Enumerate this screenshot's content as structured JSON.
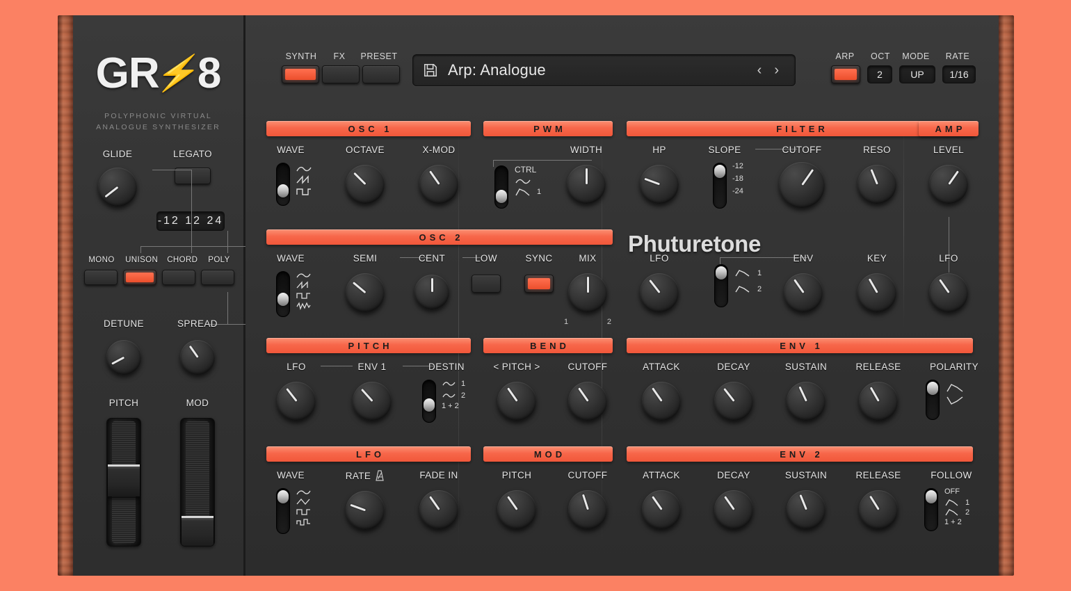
{
  "app": {
    "brand_logo": "GR",
    "brand_bolt": "⚡",
    "brand_number": "8",
    "tagline_line1": "POLYPHONIC VIRTUAL",
    "tagline_line2": "ANALOGUE SYNTHESIZER",
    "watermark": "Phuturetone",
    "accent_color": "#f1573a",
    "panel_color": "#333333",
    "wood_color": "#b35f40"
  },
  "toolbar": {
    "page_tabs": [
      {
        "label": "SYNTH",
        "active": true
      },
      {
        "label": "FX",
        "active": false
      },
      {
        "label": "PRESET",
        "active": false
      }
    ],
    "preset": {
      "save_icon": "floppy-disk-icon",
      "name": "Arp: Analogue",
      "prev": "‹",
      "next": "›"
    },
    "arp": {
      "label": "ARP",
      "enabled": true,
      "oct_label": "OCT",
      "oct_value": "2",
      "mode_label": "MODE",
      "mode_value": "UP",
      "rate_label": "RATE",
      "rate_value": "1/16"
    }
  },
  "left_panel": {
    "glide": {
      "label": "GLIDE",
      "angle": -128
    },
    "legato": {
      "label": "LEGATO",
      "on": false
    },
    "chord_readout": "-12 12 24",
    "voice_modes": [
      {
        "label": "MONO",
        "active": false
      },
      {
        "label": "UNISON",
        "active": true
      },
      {
        "label": "CHORD",
        "active": false
      },
      {
        "label": "POLY",
        "active": false
      }
    ],
    "detune": {
      "label": "DETUNE",
      "angle": -118
    },
    "spread": {
      "label": "SPREAD",
      "angle": -35
    },
    "pitch_wheel": {
      "label": "PITCH",
      "position": 50
    },
    "mod_wheel": {
      "label": "MOD",
      "position": 5
    }
  },
  "sections": {
    "osc1": {
      "title": "OSC 1",
      "wave": {
        "label": "WAVE",
        "options": [
          "sine",
          "saw",
          "square"
        ],
        "selected": 1
      },
      "octave": {
        "label": "OCTAVE",
        "angle": -45
      },
      "xmod": {
        "label": "X-MOD",
        "angle": -35
      }
    },
    "pwm": {
      "title": "PWM",
      "ctrl": {
        "label": "CTRL",
        "options": [
          "sine",
          "env-1"
        ],
        "option_labels": [
          "",
          "1"
        ],
        "selected": 1
      },
      "width": {
        "label": "WIDTH",
        "angle": 0
      }
    },
    "osc2": {
      "title": "OSC 2",
      "wave": {
        "label": "WAVE",
        "options": [
          "sine",
          "saw",
          "square",
          "noise"
        ],
        "selected": 1
      },
      "semi": {
        "label": "SEMI",
        "angle": -50
      },
      "cent": {
        "label": "CENT",
        "angle": 0
      },
      "low": {
        "label": "LOW",
        "on": false
      },
      "sync": {
        "label": "SYNC",
        "on": true
      },
      "mix": {
        "label": "MIX",
        "angle": 0,
        "min_label": "1",
        "max_label": "2"
      }
    },
    "pitch": {
      "title": "PITCH",
      "lfo": {
        "label": "LFO",
        "angle": -38
      },
      "env1": {
        "label": "ENV 1",
        "angle": -42
      },
      "destin": {
        "label": "DESTIN",
        "options": [
          "osc-1",
          "osc-2",
          "1 + 2"
        ],
        "option_labels": [
          "1",
          "2",
          "1 + 2"
        ],
        "selected": 1
      }
    },
    "bend": {
      "title": "BEND",
      "pitch": {
        "label": "< PITCH >",
        "angle": -35
      },
      "cutoff": {
        "label": "CUTOFF",
        "angle": -35
      }
    },
    "lfo": {
      "title": "LFO",
      "wave": {
        "label": "WAVE",
        "options": [
          "sine",
          "triangle",
          "square",
          "random"
        ],
        "selected": 0
      },
      "rate": {
        "label": "RATE",
        "icon": "metronome-icon",
        "angle": -70
      },
      "fade_in": {
        "label": "FADE IN",
        "angle": -35
      }
    },
    "mod": {
      "title": "MOD",
      "pitch": {
        "label": "PITCH",
        "angle": -35
      },
      "cutoff": {
        "label": "CUTOFF",
        "angle": -18
      }
    },
    "filter": {
      "title": "FILTER",
      "hp": {
        "label": "HP",
        "angle": -70
      },
      "slope": {
        "label": "SLOPE",
        "options": [
          "-12",
          "-18",
          "-24"
        ],
        "selected": 0
      },
      "cutoff": {
        "label": "CUTOFF",
        "angle": 35
      },
      "reso": {
        "label": "RESO",
        "angle": -22
      },
      "lfo": {
        "label": "LFO",
        "angle": -38
      },
      "env": {
        "label": "ENV",
        "options": [
          "1",
          "2"
        ],
        "selected": 0,
        "angle": -35
      },
      "key": {
        "label": "KEY",
        "angle": -30
      }
    },
    "amp": {
      "title": "AMP",
      "level": {
        "label": "LEVEL",
        "angle": 35
      },
      "lfo": {
        "label": "LFO",
        "angle": -35
      }
    },
    "env1": {
      "title": "ENV 1",
      "attack": {
        "label": "ATTACK",
        "angle": -35
      },
      "decay": {
        "label": "DECAY",
        "angle": -38
      },
      "sustain": {
        "label": "SUSTAIN",
        "angle": -25
      },
      "release": {
        "label": "RELEASE",
        "angle": -30
      },
      "polarity": {
        "label": "POLARITY",
        "options": [
          "positive",
          "negative"
        ],
        "selected": 0
      }
    },
    "env2": {
      "title": "ENV 2",
      "attack": {
        "label": "ATTACK",
        "angle": -35
      },
      "decay": {
        "label": "DECAY",
        "angle": -35
      },
      "sustain": {
        "label": "SUSTAIN",
        "angle": -22
      },
      "release": {
        "label": "RELEASE",
        "angle": -32
      },
      "follow": {
        "label": "FOLLOW",
        "options": [
          "OFF",
          "1",
          "2",
          "1 + 2"
        ],
        "selected": 0
      }
    }
  }
}
